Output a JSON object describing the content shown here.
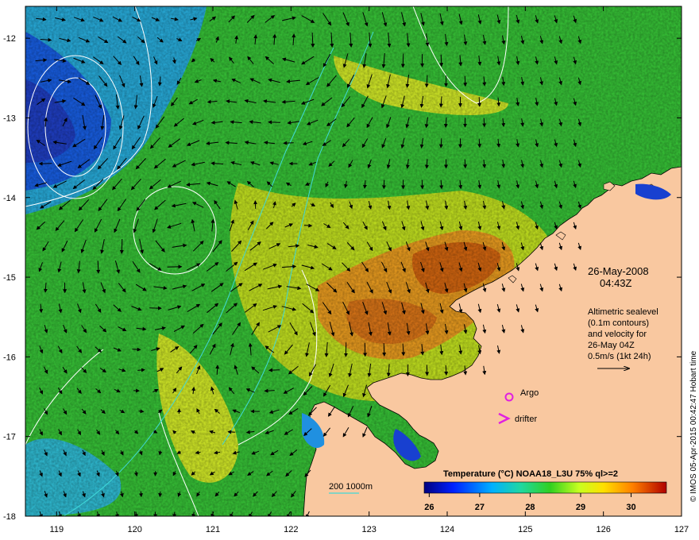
{
  "map": {
    "date": "26-May-2008",
    "time": "04:43Z",
    "lon_ticks": [
      119,
      120,
      121,
      122,
      123,
      124,
      125,
      126,
      127
    ],
    "lat_ticks": [
      -12,
      -13,
      -14,
      -15,
      -16,
      -17,
      -18
    ],
    "altimetry_lines": [
      "Altimetric sealevel",
      "(0.1m contours)",
      "and velocity for",
      "26-May 04Z",
      "0.5m/s (1kt 24h)"
    ],
    "argo_label": "Argo",
    "drifter_label": "drifter",
    "depth_label": "200  1000m",
    "credit": "© IMOS 05-Apr-2015 00:42:47 Hobart time",
    "colorbar": {
      "title": "Temperature (°C) NOAA18_L3U 75% ql>=2",
      "ticks": [
        26,
        27,
        28,
        29,
        30
      ]
    },
    "colors": {
      "land": "#f9c8a0",
      "argo": "#e020e0",
      "drifter": "#e020e0",
      "sealevel_contour": "#ffffff",
      "bathy_contour": "#40d8d8"
    }
  }
}
